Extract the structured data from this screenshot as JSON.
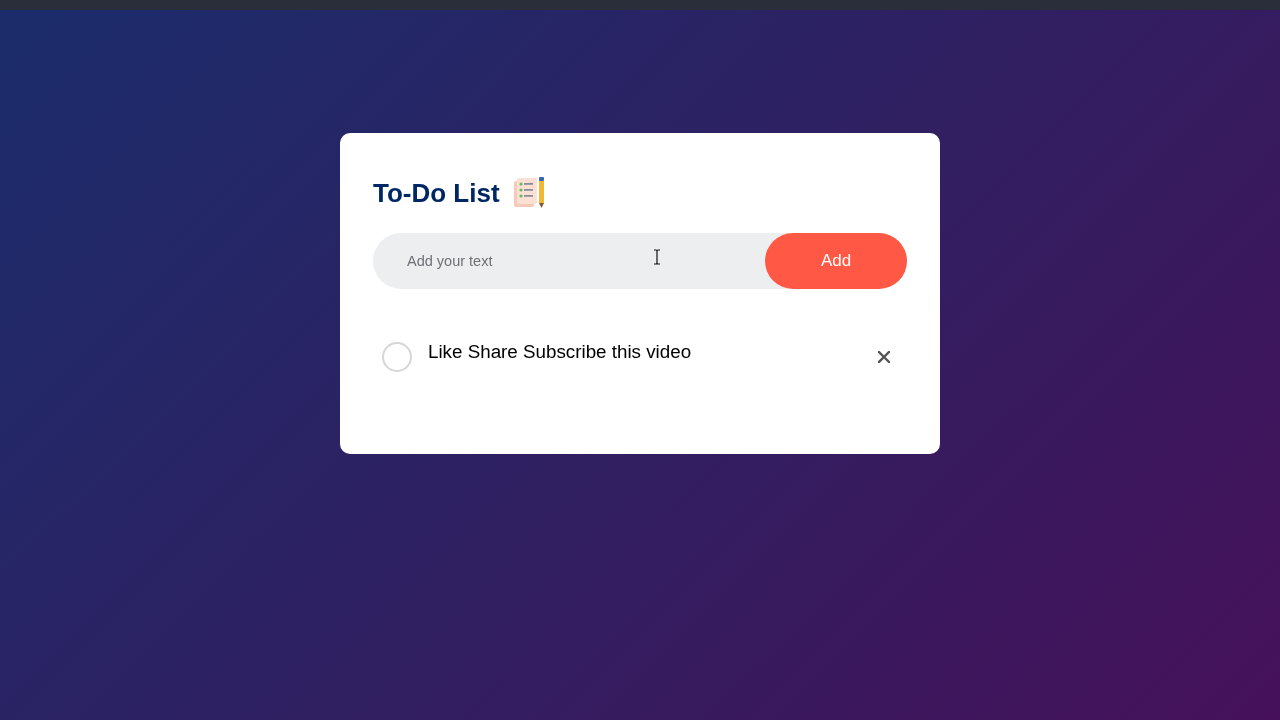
{
  "card": {
    "title": "To-Do List",
    "input": {
      "placeholder": "Add your text"
    },
    "add_button": {
      "label": "Add"
    }
  },
  "tasks": [
    {
      "text": "Like Share Subscribe this video",
      "checked": false
    }
  ]
}
